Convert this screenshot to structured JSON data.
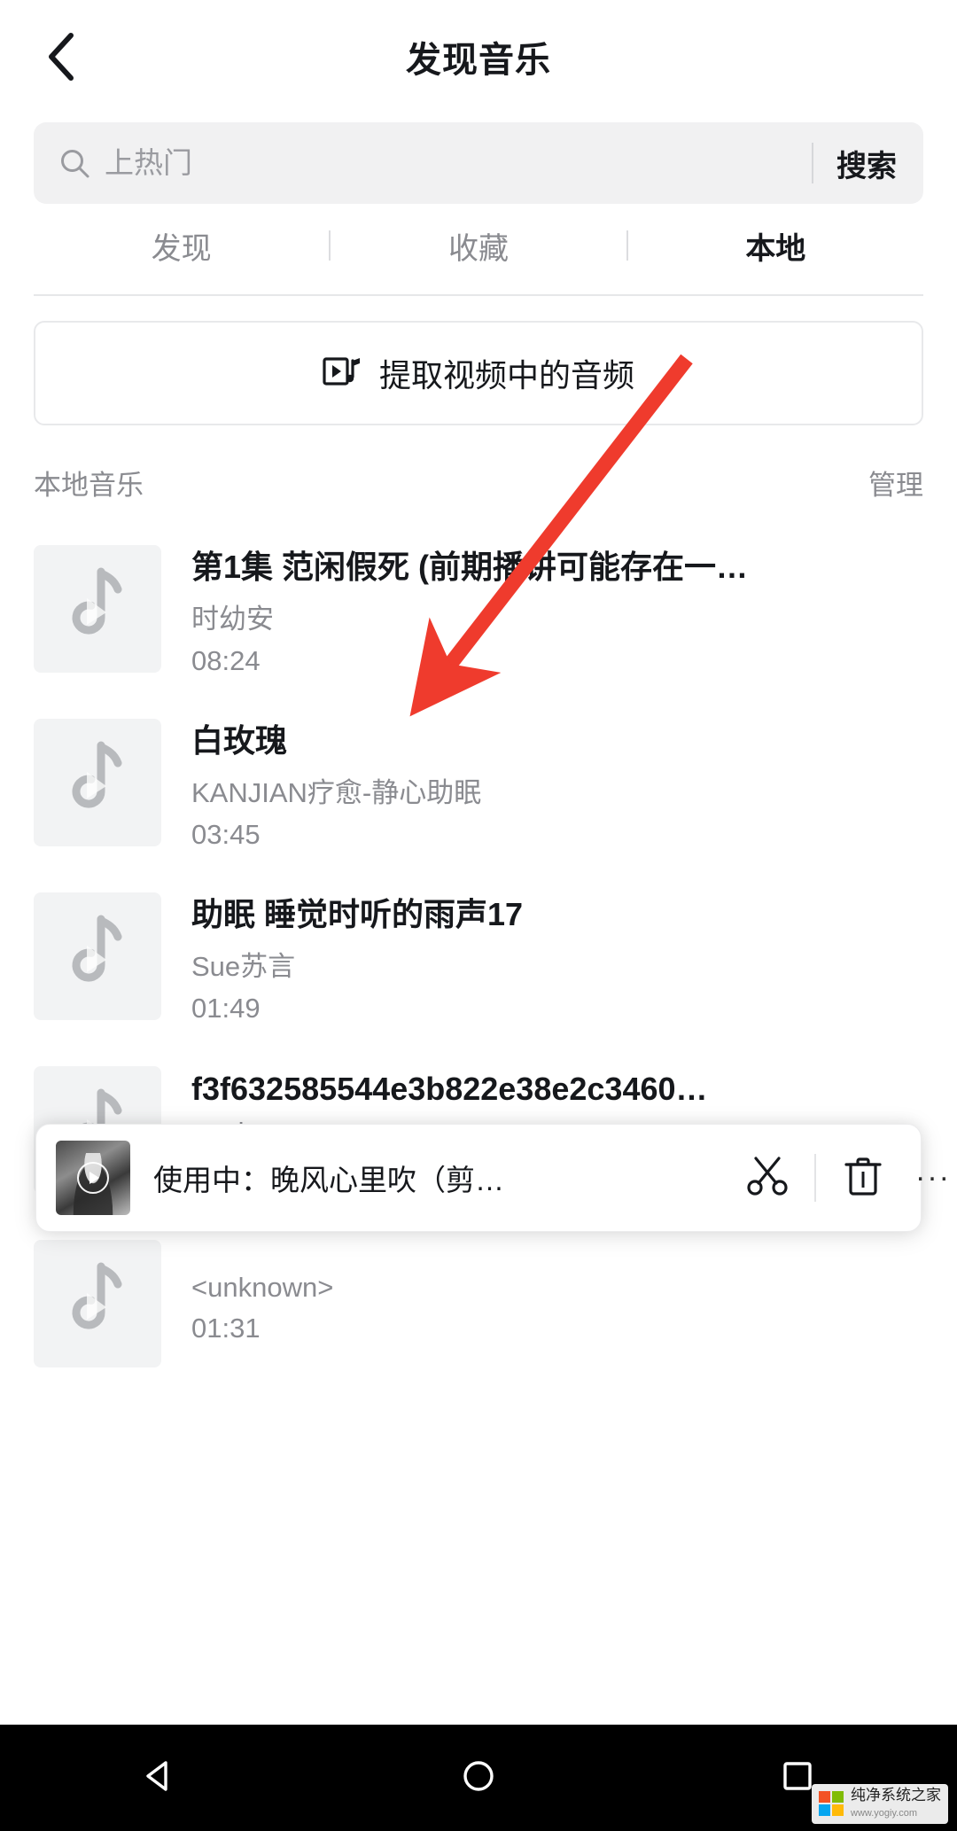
{
  "header": {
    "title": "发现音乐",
    "back_icon": "chevron-left-icon"
  },
  "search": {
    "placeholder": "上热门",
    "value": "",
    "icon": "search-icon",
    "button_label": "搜索"
  },
  "tabs": [
    {
      "label": "发现",
      "active": false
    },
    {
      "label": "收藏",
      "active": false
    },
    {
      "label": "本地",
      "active": true
    }
  ],
  "extract": {
    "label": "提取视频中的音频",
    "icon": "video-music-icon"
  },
  "section": {
    "title": "本地音乐",
    "action_label": "管理"
  },
  "songs": [
    {
      "title": "第1集 范闲假死 (前期播讲可能存在一…",
      "artist": "时幼安",
      "duration": "08:24",
      "thumb_icon": "music-note-icon"
    },
    {
      "title": "白玫瑰",
      "artist": "KANJIAN疗愈-静心助眠",
      "duration": "03:45",
      "thumb_icon": "music-note-icon"
    },
    {
      "title": "助眠 睡觉时听的雨声17",
      "artist": "Sue苏言",
      "duration": "01:49",
      "thumb_icon": "music-note-icon"
    },
    {
      "title": "f3f632585544e3b822e38e2c3460…",
      "artist": "<unknown>",
      "duration": "01:31",
      "thumb_icon": "music-note-icon"
    },
    {
      "title": "",
      "artist": "<unknown>",
      "duration": "01:31",
      "thumb_icon": "music-note-icon"
    }
  ],
  "player": {
    "label": "使用中：晚风心里吹（剪…",
    "cut_icon": "scissors-icon",
    "delete_icon": "trash-icon",
    "more_icon": "ellipsis-icon",
    "play_icon": "play-icon"
  },
  "navbar": {
    "back_icon": "triangle-back-icon",
    "home_icon": "circle-home-icon",
    "recents_icon": "square-recents-icon"
  },
  "watermark": {
    "name": "纯净系统之家",
    "url": "www.yogiy.com"
  },
  "annotation": {
    "arrow_color": "#ef3b2d"
  },
  "colors": {
    "text_primary": "#16181c",
    "text_secondary": "#8a8b90",
    "surface": "#f1f1f2",
    "accent_red": "#ef3b2d"
  }
}
